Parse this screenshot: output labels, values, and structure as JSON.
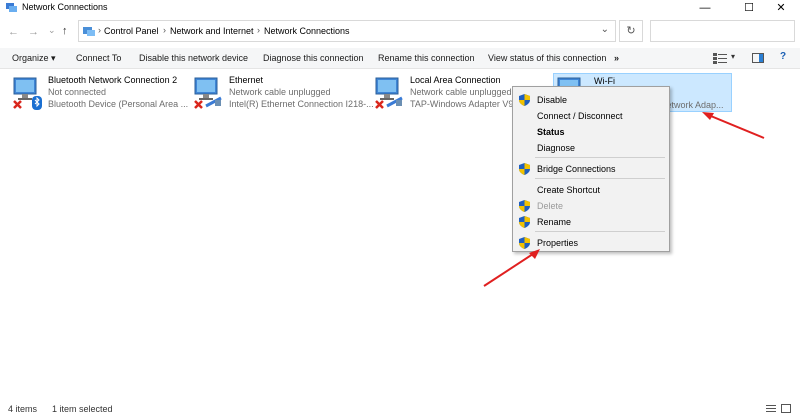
{
  "window": {
    "title": "Network Connections",
    "controls": {
      "minimize": "—",
      "maximize": "☐",
      "close": "✕"
    }
  },
  "address": {
    "crumbs": [
      "Control Panel",
      "Network and Internet",
      "Network Connections"
    ],
    "separator": "›",
    "dropdown": "⌄",
    "refresh": "↻",
    "nav": {
      "back": "←",
      "forward": "→",
      "recent": "⌄",
      "up": "↑"
    }
  },
  "toolbar": {
    "organize": "Organize ▾",
    "connect_to": "Connect To",
    "disable_device": "Disable this network device",
    "diagnose": "Diagnose this connection",
    "rename": "Rename this connection",
    "view_status": "View status of this connection",
    "more": "»"
  },
  "connections": [
    {
      "name": "Bluetooth Network Connection 2",
      "status": "Not connected",
      "device": "Bluetooth Device (Personal Area ...",
      "icon": "bluetooth-network-icon"
    },
    {
      "name": "Ethernet",
      "status": "Network cable unplugged",
      "device": "Intel(R) Ethernet Connection I218-...",
      "icon": "ethernet-icon"
    },
    {
      "name": "Local Area Connection",
      "status": "Network cable unplugged",
      "device": "TAP-Windows Adapter V9",
      "icon": "lan-icon"
    },
    {
      "name": "Wi-Fi",
      "status": "",
      "device": "Network Adap...",
      "icon": "wifi-adapter-icon"
    }
  ],
  "context_menu": {
    "items": [
      {
        "label": "Disable",
        "shield": true
      },
      {
        "label": "Connect / Disconnect",
        "shield": false
      },
      {
        "label": "Status",
        "shield": false,
        "bold": true
      },
      {
        "label": "Diagnose",
        "shield": false
      },
      {
        "label": "Bridge Connections",
        "shield": true
      },
      {
        "label": "Create Shortcut",
        "shield": false
      },
      {
        "label": "Delete",
        "shield": true,
        "disabled": true
      },
      {
        "label": "Rename",
        "shield": true
      },
      {
        "label": "Properties",
        "shield": true
      }
    ]
  },
  "statusbar": {
    "items_count": "4 items",
    "selected": "1 item selected"
  },
  "colors": {
    "selection": "#cce8ff",
    "annotation_arrow": "#e02020",
    "error_x": "#d9261c"
  }
}
